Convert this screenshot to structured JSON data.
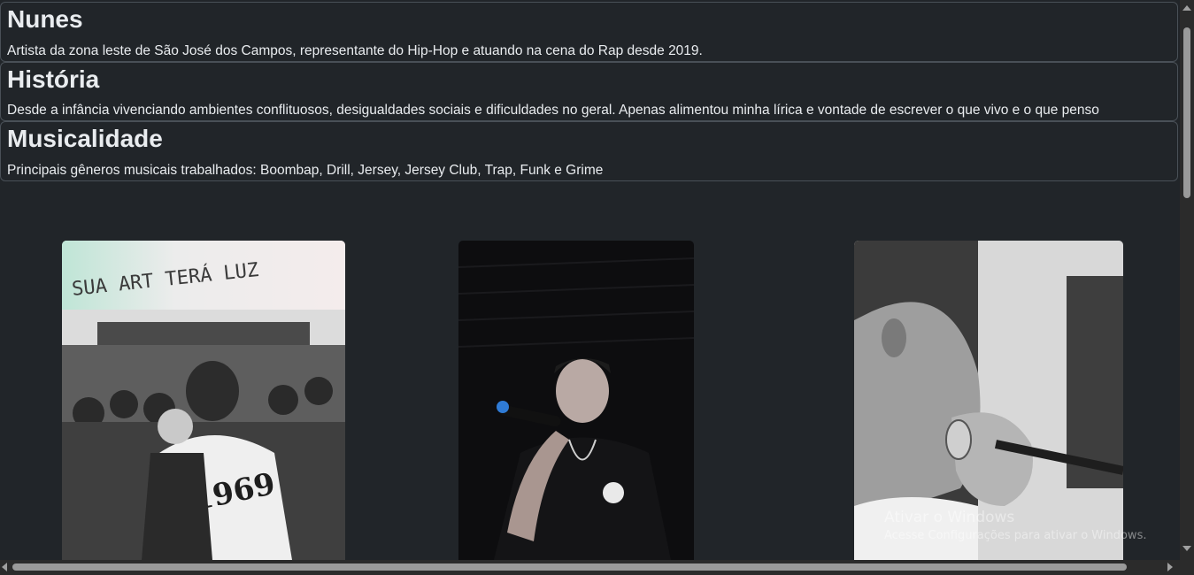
{
  "sections": [
    {
      "title": "Nunes",
      "text": "Artista da zona leste de São José dos Campos, representante do Hip-Hop e atuando na cena do Rap desde 2019."
    },
    {
      "title": "História",
      "text": "Desde a infância vivenciando ambientes conflituosos, desigualdades sociais e dificuldades no geral. Apenas alimentou minha lírica e vontade de escrever o que vivo e o que penso"
    },
    {
      "title": "Musicalidade",
      "text": "Principais gêneros musicais trabalhados: Boombap, Drill, Jersey, Jersey Club, Trap, Funk e Grime"
    }
  ],
  "photos": [
    {
      "icon": "crowd-performance-photo",
      "caption_in_image": "SUA ART TERÁ LUZ",
      "shirt_number": "1969"
    },
    {
      "icon": "microphone-performer-photo"
    },
    {
      "icon": "mic-closeup-photo"
    }
  ],
  "watermark": {
    "title": "Ativar o Windows",
    "subtitle": "Acesse Configurações para ativar o Windows."
  },
  "colors": {
    "background": "#212529",
    "border": "#495057",
    "text": "#e9ecef"
  }
}
